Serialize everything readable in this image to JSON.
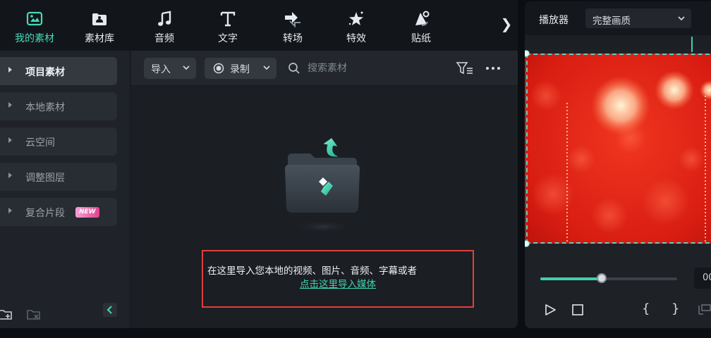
{
  "toolbar": {
    "tools": [
      {
        "label": "我的素材",
        "icon": "my-media-icon",
        "active": true
      },
      {
        "label": "素材库",
        "icon": "stock-media-icon",
        "active": false
      },
      {
        "label": "音频",
        "icon": "music-note-icon",
        "active": false
      },
      {
        "label": "文字",
        "icon": "text-t-icon",
        "active": false
      },
      {
        "label": "转场",
        "icon": "transition-icon",
        "active": false
      },
      {
        "label": "特效",
        "icon": "effects-star-icon",
        "active": false
      },
      {
        "label": "贴纸",
        "icon": "sticker-icon",
        "active": false
      }
    ],
    "more": "❯"
  },
  "sidebar": {
    "items": [
      {
        "label": "项目素材",
        "active": true
      },
      {
        "label": "本地素材",
        "active": false
      },
      {
        "label": "云空间",
        "active": false
      },
      {
        "label": "调整图层",
        "active": false
      },
      {
        "label": "复合片段",
        "active": false,
        "badge": "NEW"
      }
    ]
  },
  "content": {
    "import_label": "导入",
    "record_label": "录制",
    "search_placeholder": "搜索素材",
    "empty_hint": "在这里导入您本地的视频、图片、音频、字幕或者",
    "empty_link": "点击这里导入媒体"
  },
  "player": {
    "title": "播放器",
    "quality": "完整画质",
    "progress": 0.45,
    "timecode": "00"
  },
  "colors": {
    "accent": "#3fd1ae",
    "highlight_border": "#e0403d",
    "badge_gradient": [
      "#f4a2d7",
      "#e2408d"
    ]
  }
}
